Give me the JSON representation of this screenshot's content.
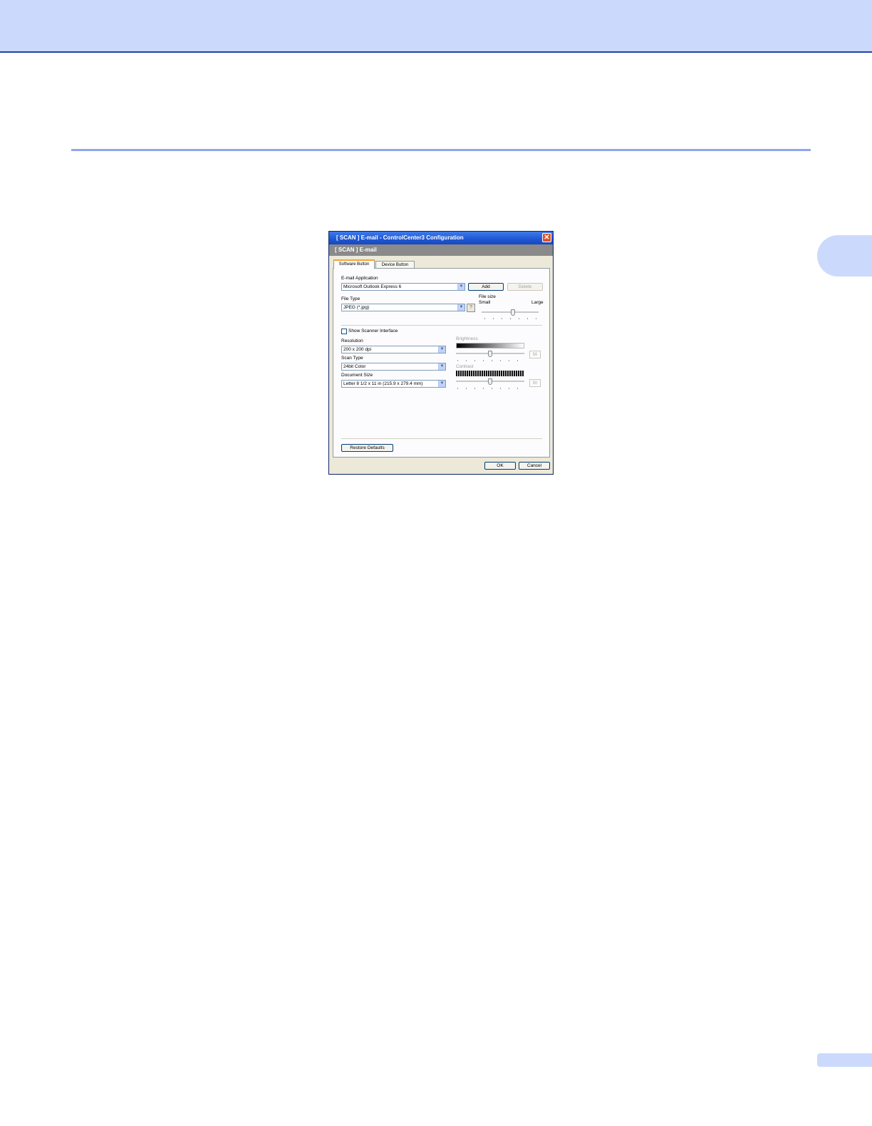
{
  "dialog": {
    "title": "[ SCAN ]  E-mail - ControlCenter3 Configuration",
    "close_glyph": "✕",
    "banner": "[ SCAN ]  E-mail",
    "tabs": [
      {
        "label": "Software Button"
      },
      {
        "label": "Device Button"
      }
    ],
    "email_app": {
      "label": "E-mail Application",
      "value": "Microsoft Outlook Express 6",
      "add": "Add",
      "delete": "Delete"
    },
    "file_type": {
      "label": "File Type",
      "value": "JPEG (*.jpg)",
      "help_glyph": "?"
    },
    "file_size": {
      "label": "File size",
      "small": "Small",
      "large": "Large",
      "level": 0.55
    },
    "show_scanner_interface": {
      "label": "Show Scanner Interface",
      "checked": false
    },
    "resolution": {
      "label": "Resolution",
      "value": "200 x 200 dpi"
    },
    "scan_type": {
      "label": "Scan Type",
      "value": "24bit Color"
    },
    "document_size": {
      "label": "Document Size",
      "value": "Letter 8 1/2 x 11 in (215.9 x 279.4 mm)"
    },
    "brightness": {
      "label": "Brightness",
      "value": "50",
      "level": 0.5
    },
    "contrast": {
      "label": "Contrast",
      "value": "50",
      "level": 0.5
    },
    "restore_defaults": "Restore Defaults",
    "ok": "OK",
    "cancel": "Cancel",
    "dropdown_glyph": "▼"
  }
}
